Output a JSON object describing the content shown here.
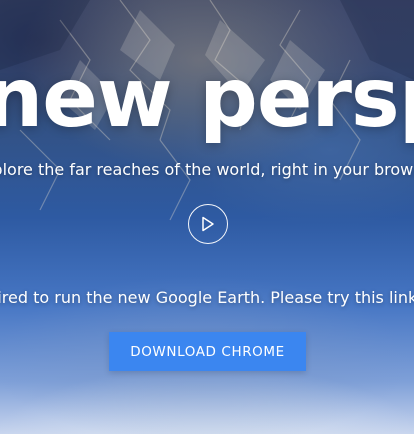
{
  "hero": {
    "headline": "a new perspe",
    "subline": "plore the far reaches of the world, right in your brows",
    "play_icon": "play-icon",
    "notice": "uired to run the new Google Earth. Please try this link i",
    "cta_label": "DOWNLOAD CHROME"
  },
  "colors": {
    "cta_background": "#3b86f0",
    "text": "#ffffff"
  }
}
